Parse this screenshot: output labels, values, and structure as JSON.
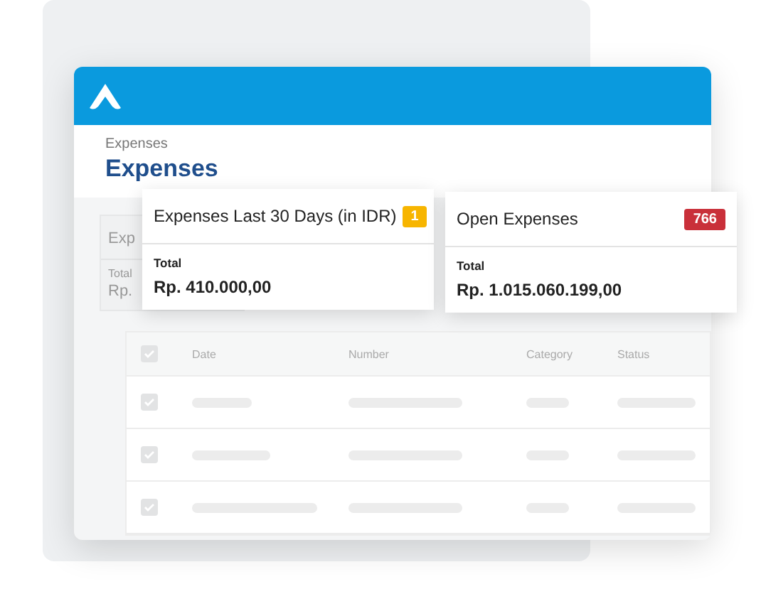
{
  "window": {
    "breadcrumb": "Expenses",
    "title": "Expenses"
  },
  "background_card": {
    "title": "Exp",
    "label": "Total",
    "value": "Rp."
  },
  "summary_cards": [
    {
      "title": "Expenses Last 30 Days (in IDR)",
      "badge": "1",
      "color": "#f7b500",
      "label": "Total",
      "value": "Rp. 410.000,00"
    },
    {
      "title": "Open Expenses",
      "badge": "766",
      "color": "#c9303a",
      "label": "Total",
      "value": "Rp. 1.015.060.199,00"
    }
  ],
  "table": {
    "select_all_checked": true,
    "columns": [
      "Date",
      "Number",
      "Category",
      "Status"
    ],
    "rows": [
      {
        "checked": true
      },
      {
        "checked": true
      },
      {
        "checked": true
      }
    ]
  }
}
